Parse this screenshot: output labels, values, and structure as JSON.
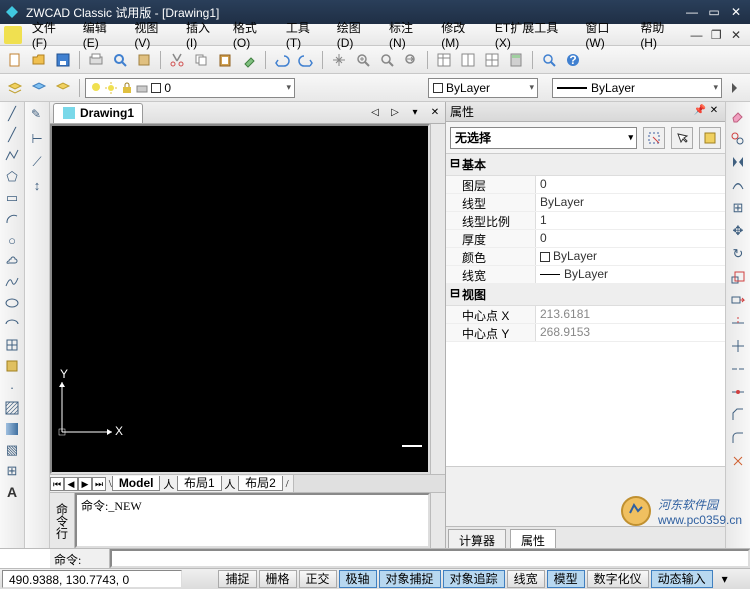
{
  "title": "ZWCAD Classic 试用版 - [Drawing1]",
  "menu": [
    "文件(F)",
    "编辑(E)",
    "视图(V)",
    "插入(I)",
    "格式(O)",
    "工具(T)",
    "绘图(D)",
    "标注(N)",
    "修改(M)",
    "ET扩展工具(X)",
    "窗口(W)",
    "帮助(H)"
  ],
  "layerBar": {
    "layer": "0",
    "bylayer1": "ByLayer",
    "bylayer2": "ByLayer"
  },
  "docTab": "Drawing1",
  "layouts": {
    "model": "Model",
    "l1": "布局1",
    "l2": "布局2"
  },
  "properties": {
    "title": "属性",
    "selection": "无选择",
    "cats": {
      "basic": "基本",
      "view": "视图"
    },
    "rows": {
      "layer": {
        "k": "图层",
        "v": "0"
      },
      "linetype": {
        "k": "线型",
        "v": "ByLayer"
      },
      "ltscale": {
        "k": "线型比例",
        "v": "1"
      },
      "thickness": {
        "k": "厚度",
        "v": "0"
      },
      "color": {
        "k": "颜色",
        "v": "ByLayer"
      },
      "lineweight": {
        "k": "线宽",
        "v": "ByLayer"
      },
      "centerx": {
        "k": "中心点 X",
        "v": "213.6181"
      },
      "centery": {
        "k": "中心点 Y",
        "v": "268.9153"
      }
    },
    "tabs": {
      "calc": "计算器",
      "prop": "属性"
    }
  },
  "command": {
    "history": "命令:_NEW",
    "prompt": "命令: ",
    "sideLabel": "命令行"
  },
  "status": {
    "coords": "490.9388, 130.7743, 0",
    "snaps": [
      "捕捉",
      "栅格",
      "正交",
      "极轴",
      "对象捕捉",
      "对象追踪",
      "线宽",
      "模型",
      "数字化仪",
      "动态输入"
    ]
  },
  "watermark": {
    "name": "河东软件园",
    "url": "www.pc0359.cn"
  }
}
